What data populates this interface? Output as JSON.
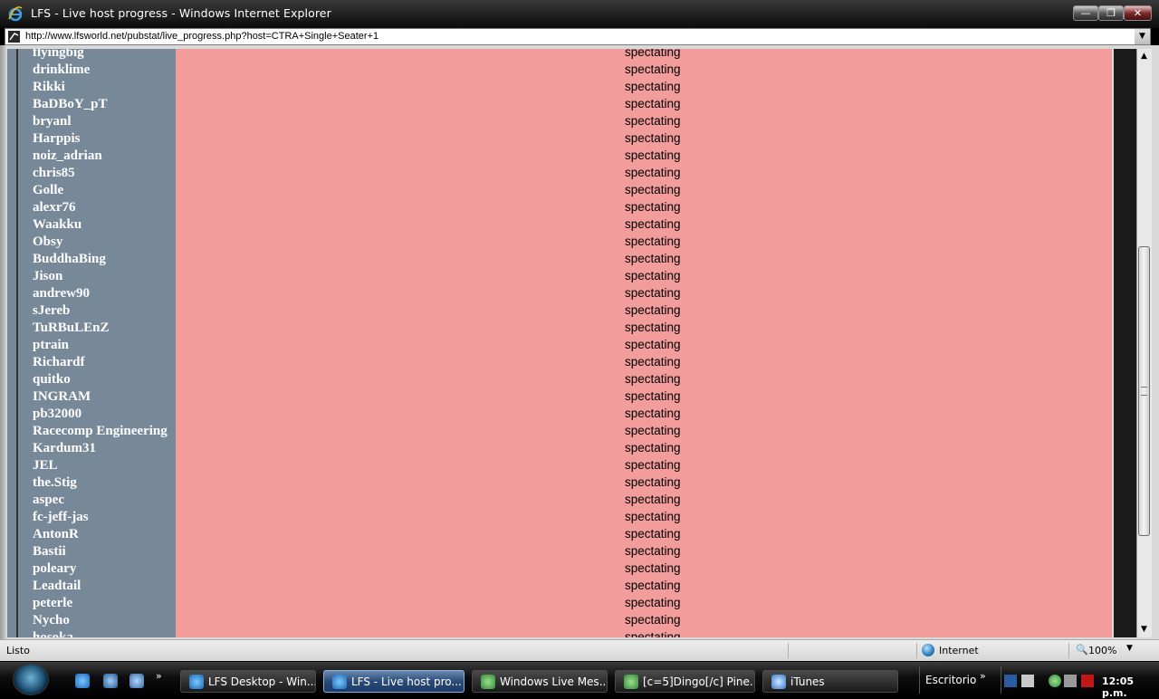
{
  "window": {
    "title": "LFS - Live host progress - Windows Internet Explorer",
    "min_label": "—",
    "max_label": "❐",
    "close_label": "✕"
  },
  "address": {
    "url": "http://www.lfsworld.net/pubstat/live_progress.php?host=CTRA+Single+Seater+1",
    "dropdown": "▼"
  },
  "players": [
    {
      "name": "flyingbig",
      "status": "spectating"
    },
    {
      "name": "drinklime",
      "status": "spectating"
    },
    {
      "name": "Rikki",
      "status": "spectating"
    },
    {
      "name": "BaDBoY_pT",
      "status": "spectating"
    },
    {
      "name": "bryanl",
      "status": "spectating"
    },
    {
      "name": "Harppis",
      "status": "spectating"
    },
    {
      "name": "noiz_adrian",
      "status": "spectating"
    },
    {
      "name": "chris85",
      "status": "spectating"
    },
    {
      "name": "Golle",
      "status": "spectating"
    },
    {
      "name": "alexr76",
      "status": "spectating"
    },
    {
      "name": "Waakku",
      "status": "spectating"
    },
    {
      "name": "Obsy",
      "status": "spectating"
    },
    {
      "name": "BuddhaBing",
      "status": "spectating"
    },
    {
      "name": "Jison",
      "status": "spectating"
    },
    {
      "name": "andrew90",
      "status": "spectating"
    },
    {
      "name": "sJereb",
      "status": "spectating"
    },
    {
      "name": "TuRBuLEnZ",
      "status": "spectating"
    },
    {
      "name": "ptrain",
      "status": "spectating"
    },
    {
      "name": "Richardf",
      "status": "spectating"
    },
    {
      "name": "quitko",
      "status": "spectating"
    },
    {
      "name": "INGRAM",
      "status": "spectating"
    },
    {
      "name": "pb32000",
      "status": "spectating"
    },
    {
      "name": "Racecomp Engineering",
      "status": "spectating"
    },
    {
      "name": "Kardum31",
      "status": "spectating"
    },
    {
      "name": "JEL",
      "status": "spectating"
    },
    {
      "name": "the.Stig",
      "status": "spectating"
    },
    {
      "name": "aspec",
      "status": "spectating"
    },
    {
      "name": "fc-jeff-jas",
      "status": "spectating"
    },
    {
      "name": "AntonR",
      "status": "spectating"
    },
    {
      "name": "Bastii",
      "status": "spectating"
    },
    {
      "name": "poleary",
      "status": "spectating"
    },
    {
      "name": "Leadtail",
      "status": "spectating"
    },
    {
      "name": "peterle",
      "status": "spectating"
    },
    {
      "name": "Nycho",
      "status": "spectating"
    },
    {
      "name": "hosoka",
      "status": "spectating"
    }
  ],
  "scrollbar": {
    "up": "▲",
    "down": "▼"
  },
  "statusbar": {
    "status": "Listo",
    "zone": "Internet",
    "zoom": "100%",
    "zoom_icon": "🔍",
    "zoom_dropdown": "▼"
  },
  "taskbar": {
    "tasks": [
      {
        "label": "LFS Desktop - Win...",
        "active": false
      },
      {
        "label": "LFS - Live host pro...",
        "active": true
      },
      {
        "label": "Windows Live Mes...",
        "active": false
      },
      {
        "label": "[c=5]Dingo[/c] Pine...",
        "active": false
      },
      {
        "label": "iTunes",
        "active": false
      }
    ],
    "toolbar_label": "Escritorio",
    "overflow": "»",
    "time": "12:05 p.m."
  },
  "colors": {
    "page_bg": "#f29c9c",
    "name_column": "#778899"
  }
}
